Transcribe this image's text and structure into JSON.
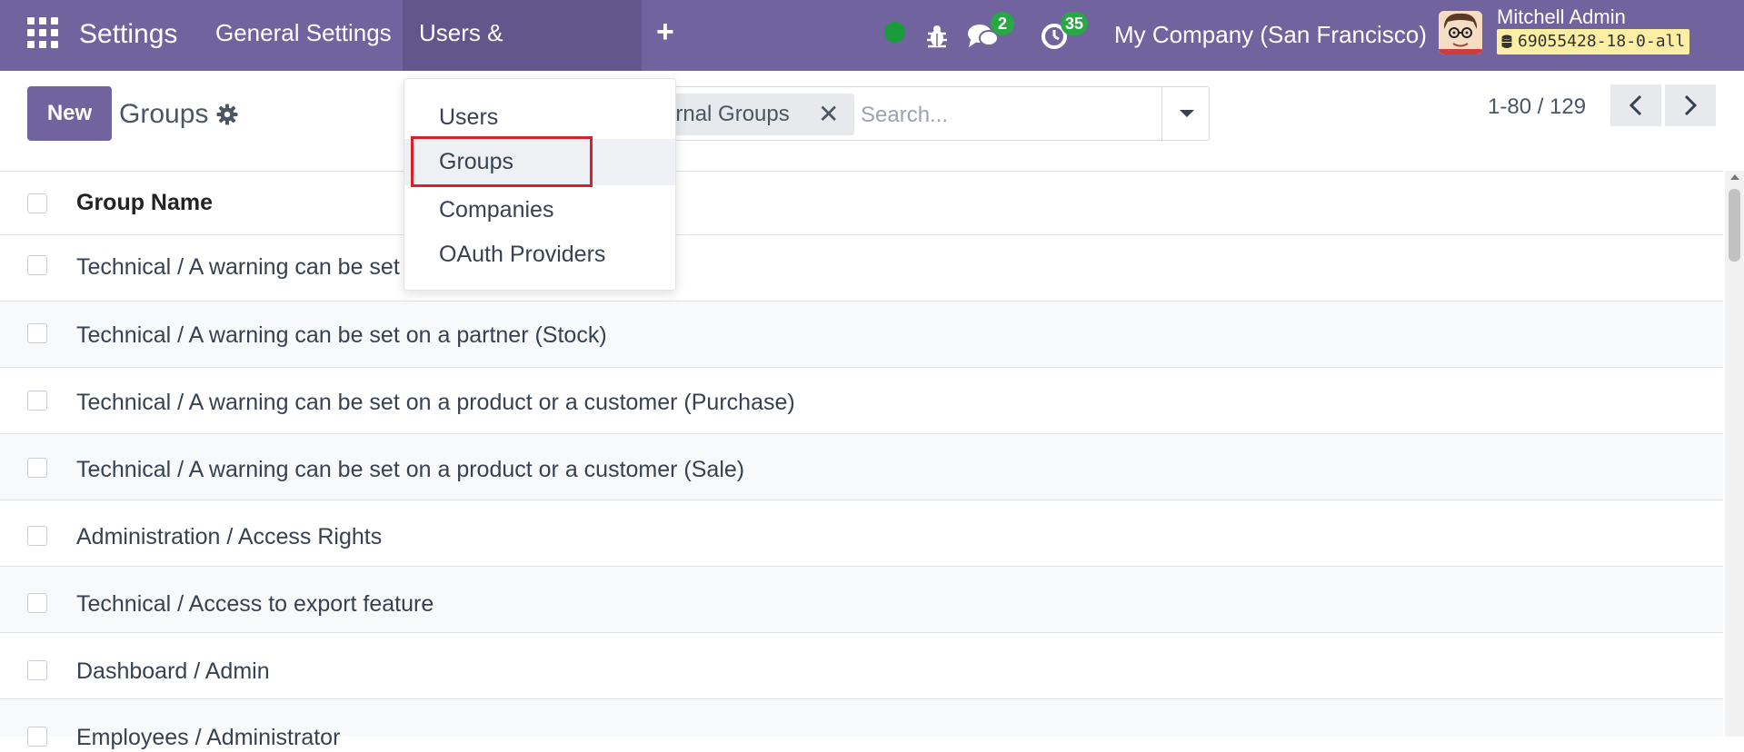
{
  "navbar": {
    "app_name": "Settings",
    "menu": [
      "General Settings",
      "Users & Companies"
    ],
    "messages_count": "2",
    "activities_count": "35",
    "company": "My Company (San Francisco)",
    "user_name": "Mitchell Admin",
    "database": "69055428-18-0-all"
  },
  "control_panel": {
    "new_label": "New",
    "title": "Groups",
    "facet_label": "ernal Groups",
    "search_placeholder": "Search...",
    "pager": "1-80 / 129"
  },
  "list": {
    "column_header": "Group Name",
    "rows": [
      "Technical / A warning can be set",
      "Technical / A warning can be set on a partner (Stock)",
      "Technical / A warning can be set on a product or a customer (Purchase)",
      "Technical / A warning can be set on a product or a customer (Sale)",
      "Administration / Access Rights",
      "Technical / Access to export feature",
      "Dashboard / Admin",
      "Employees / Administrator"
    ]
  },
  "dropdown": {
    "items": [
      "Users",
      "Groups",
      "Companies",
      "OAuth Providers"
    ],
    "active_item": "Groups"
  },
  "colors": {
    "brand": "#71639e",
    "badge": "#28a745",
    "status_online": "#1a9c3c",
    "highlight": "#d6222d"
  }
}
